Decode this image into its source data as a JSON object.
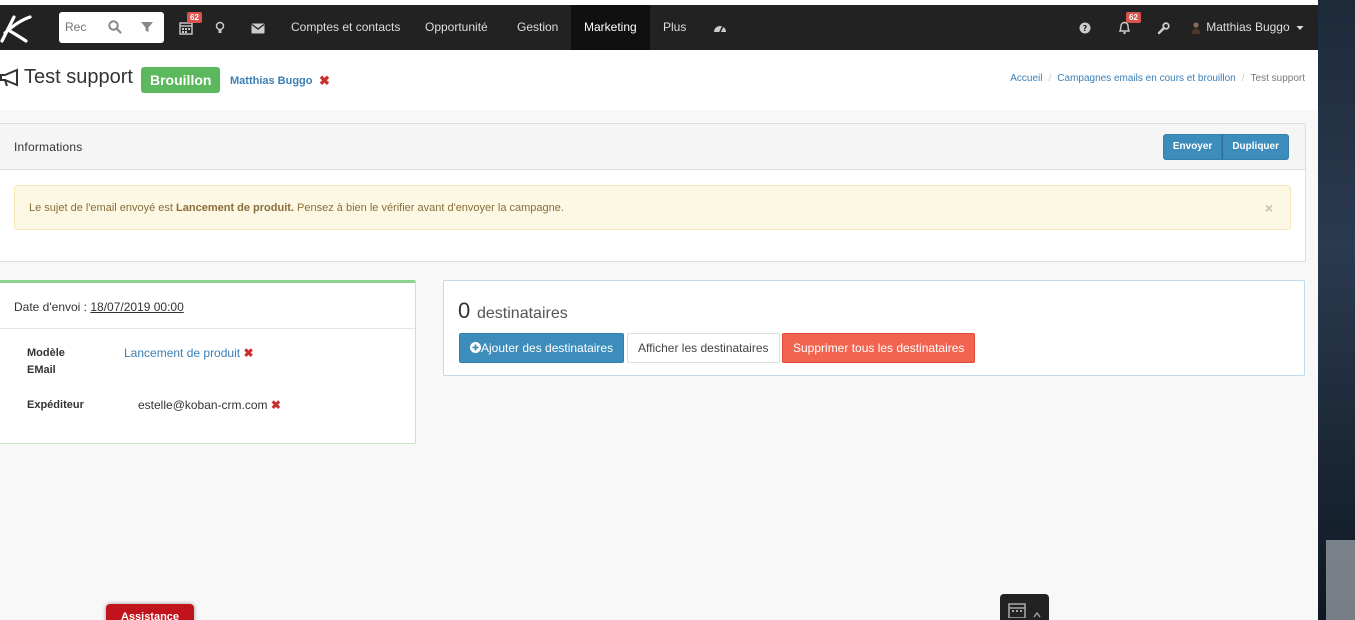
{
  "navbar": {
    "search_placeholder": "Rec",
    "calendar_badge": "62",
    "notifications_badge": "62",
    "links": [
      "Comptes et contacts",
      "Opportunité",
      "Gestion",
      "Marketing",
      "Plus"
    ],
    "active_link": "Marketing",
    "user_name": "Matthias Buggo"
  },
  "header": {
    "title": "Test support",
    "status": "Brouillon",
    "owner": "Matthias Buggo",
    "breadcrumb": [
      "Accueil",
      "Campagnes emails en cours et brouillon",
      "Test support"
    ]
  },
  "info_panel": {
    "title": "Informations",
    "send_button": "Envoyer",
    "duplicate_button": "Dupliquer",
    "alert_prefix": "Le sujet de l'email envoyé est ",
    "alert_subject": "Lancement de produit.",
    "alert_suffix": " Pensez à bien le vérifier avant d'envoyer la campagne.",
    "alert_close": "×"
  },
  "date_box": {
    "date_label": "Date d'envoi : ",
    "date_value": "18/07/2019 00:00",
    "template_label_1": "Modèle",
    "template_label_2": "EMail",
    "template_value": "Lancement de produit",
    "sender_label": "Expéditeur",
    "sender_value": "estelle@koban-crm.com"
  },
  "recipients": {
    "count": "0",
    "label": "destinataires",
    "add_button": "Ajouter des destinataires",
    "show_button": "Afficher les destinataires",
    "delete_button": "Supprimer tous les destinataires"
  },
  "bottom": {
    "assist_label": "Assistance"
  },
  "colors": {
    "navbar_bg": "#222222",
    "primary": "#3c8dbc",
    "success": "#5cb85c",
    "danger": "#f26450",
    "link": "#3a7fb6",
    "warning_bg": "#fcf8e3"
  }
}
